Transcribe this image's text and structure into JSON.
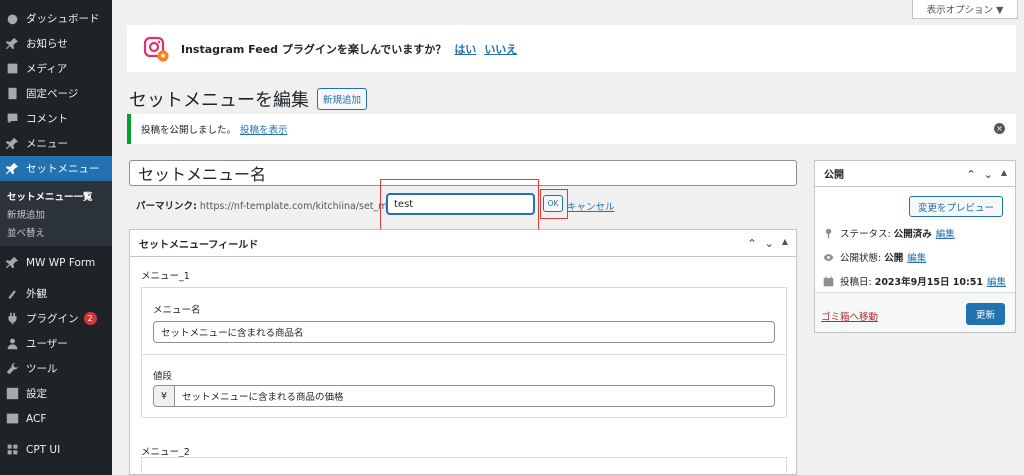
{
  "screen_options": "表示オプション ▼",
  "sidebar": {
    "items": [
      {
        "label": "ダッシュボード",
        "icon": "dashboard-icon"
      },
      {
        "label": "お知らせ",
        "icon": "pin-icon"
      },
      {
        "label": "メディア",
        "icon": "media-icon"
      },
      {
        "label": "固定ページ",
        "icon": "page-icon"
      },
      {
        "label": "コメント",
        "icon": "comment-icon"
      },
      {
        "label": "メニュー",
        "icon": "pin-icon"
      },
      {
        "label": "セットメニュー",
        "icon": "pin-icon"
      },
      {
        "label": "MW WP Form",
        "icon": "pin-icon"
      },
      {
        "label": "外観",
        "icon": "appearance-icon"
      },
      {
        "label": "プラグイン",
        "icon": "plugin-icon",
        "badge": "2"
      },
      {
        "label": "ユーザー",
        "icon": "user-icon"
      },
      {
        "label": "ツール",
        "icon": "wrench-icon"
      },
      {
        "label": "設定",
        "icon": "settings-icon"
      },
      {
        "label": "ACF",
        "icon": "acf-icon"
      },
      {
        "label": "CPT UI",
        "icon": "cptui-icon"
      }
    ],
    "submenu": [
      "セットメニュー一覧",
      "新規追加",
      "並べ替え"
    ]
  },
  "notice": {
    "text": "Instagram Feed プラグインを楽しんでいますか？",
    "yes": "はい",
    "no": "いいえ"
  },
  "page": {
    "title": "セットメニューを編集",
    "add_new": "新規追加"
  },
  "updated": {
    "text": "投稿を公開しました。",
    "link": "投稿を表示",
    "dismiss": "×"
  },
  "post": {
    "title": "セットメニュー名",
    "permalink_label": "パーマリンク:",
    "permalink_base": "https://nf-template.com/kitchiina/set_menu/",
    "slug": "test",
    "ok": "OK",
    "cancel": "キャンセル"
  },
  "fields_box": {
    "title": "セットメニューフィールド",
    "group1": "メニュー_1",
    "name_label": "メニュー名",
    "name_value": "セットメニューに含まれる商品名",
    "price_label": "値段",
    "price_prefix": "¥",
    "price_value": "セットメニューに含まれる商品の価格",
    "group2": "メニュー_2"
  },
  "publish": {
    "title": "公開",
    "preview": "変更をプレビュー",
    "status_label": "ステータス:",
    "status_value": "公開済み",
    "visibility_label": "公開状態:",
    "visibility_value": "公開",
    "date_label": "投稿日:",
    "date_value": "2023年9月15日 10:51",
    "edit": "編集",
    "trash": "ゴミ箱へ移動",
    "update": "更新"
  },
  "controls": {
    "up": "⌃",
    "down": "⌄",
    "toggle": "▲"
  }
}
